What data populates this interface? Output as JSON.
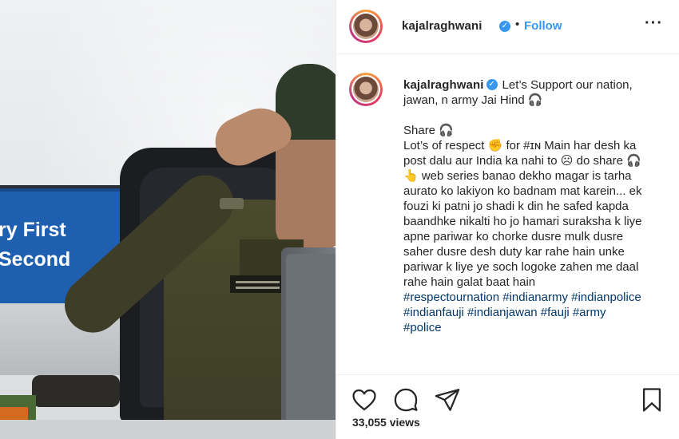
{
  "media": {
    "screen_line1": "ry First",
    "screen_line2": "Second"
  },
  "header": {
    "username": "kajalraghwani",
    "separator": "•",
    "follow_label": "Follow",
    "more_label": "···"
  },
  "caption": {
    "username": "kajalraghwani",
    "text": "Let’s Support our nation, jawan, n army Jai Hind 🎧\n\nShare 🎧\nLot’s of respect ✊ for #ɪɴ Main har desh ka post dalu aur India ka nahi to ☹ do share 🎧👆 web series banao dekho magar is tarha aurato ko lakiyon ko badnam mat karein... ek fouzi ki patni jo shadi k din he safed kapda baandhke nikalti ho jo hamari suraksha k liye apne pariwar ko chorke dusre mulk dusre saher dusre desh duty kar rahe hain unke pariwar k liye ye soch logoke zahen me daal rahe hain galat baat hain",
    "hashtags": "#respectournation #indianarmy #indianpolice #indianfauji #indianjawan #fauji #army #police"
  },
  "actions": {
    "views": "33,055 views"
  },
  "icons": {
    "verified": "verified-badge-icon",
    "like": "heart-icon",
    "comment": "comment-icon",
    "share": "paper-plane-icon",
    "save": "bookmark-icon",
    "more": "ellipsis-icon"
  },
  "colors": {
    "accent": "#3897f0",
    "hashtag": "#00376b",
    "text": "#262626",
    "screen_blue": "#1e5fb0"
  }
}
